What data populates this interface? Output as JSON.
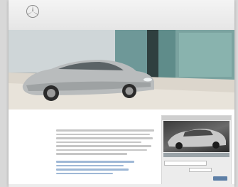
{
  "header": {
    "logo_word": "",
    "utility_text": "",
    "top_links": [
      "",
      ""
    ],
    "nav_items": [
      "",
      "",
      "",
      "",
      "",
      ""
    ]
  },
  "hero": {
    "alt": ""
  },
  "welcome": {
    "title": "",
    "subtitle": ""
  },
  "side_panel": {
    "header": "",
    "caption": "",
    "select_value": "",
    "label": "",
    "button_label": ""
  },
  "colors": {
    "accent": "#5d7fa6",
    "link": "#9fb8d6",
    "header_bg": "#f0f0f0"
  }
}
